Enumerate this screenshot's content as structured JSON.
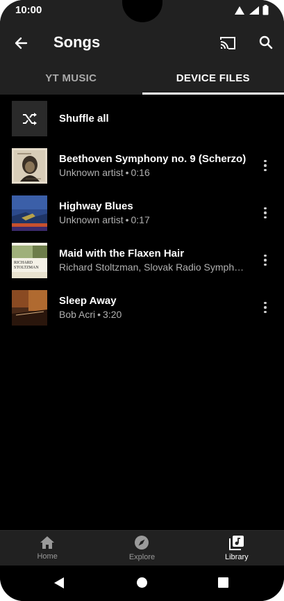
{
  "status": {
    "time": "10:00"
  },
  "appbar": {
    "title": "Songs"
  },
  "tabs": [
    {
      "label": "YT MUSIC",
      "active": false
    },
    {
      "label": "DEVICE FILES",
      "active": true
    }
  ],
  "shuffle": {
    "label": "Shuffle all"
  },
  "songs": [
    {
      "title": "Beethoven Symphony no. 9 (Scherzo)",
      "artist": "Unknown artist",
      "duration": "0:16"
    },
    {
      "title": "Highway Blues",
      "artist": "Unknown artist",
      "duration": "0:17"
    },
    {
      "title": "Maid with the Flaxen Hair",
      "artist": "Richard Stoltzman, Slovak Radio Symph…",
      "duration": ""
    },
    {
      "title": "Sleep Away",
      "artist": "Bob Acri",
      "duration": "3:20"
    }
  ],
  "album_art_text": {
    "maid": [
      "RICHARD",
      "STOLTZMAN"
    ]
  },
  "bottom_nav": [
    {
      "label": "Home",
      "icon": "home-icon",
      "active": false
    },
    {
      "label": "Explore",
      "icon": "compass-icon",
      "active": false
    },
    {
      "label": "Library",
      "icon": "library-icon",
      "active": true
    }
  ],
  "separator": "•",
  "colors": {
    "background": "#000000",
    "bar": "#212121",
    "secondary_text": "#b0b0b0"
  }
}
